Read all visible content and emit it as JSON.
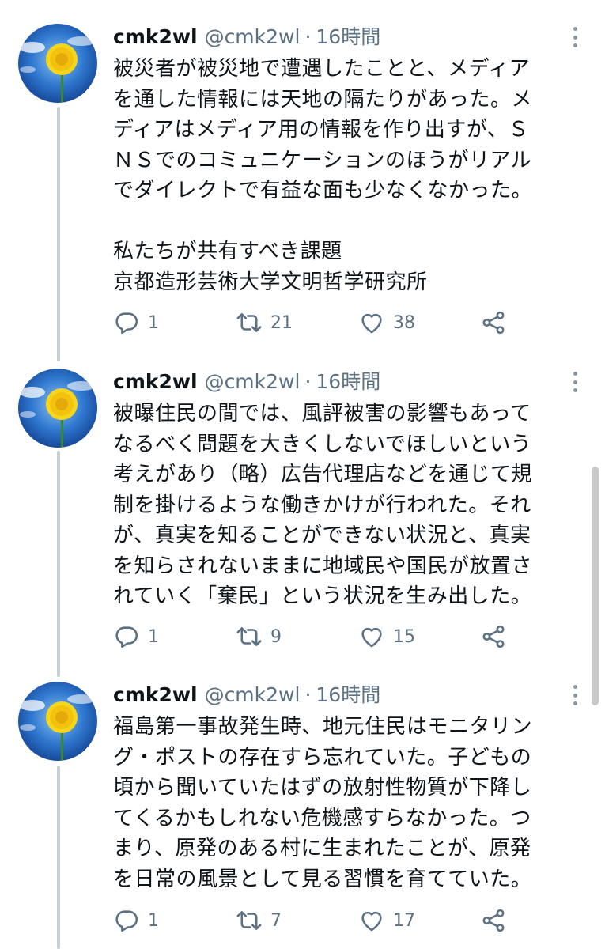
{
  "colors": {
    "text_primary": "#0f1419",
    "text_secondary": "#5b7083",
    "thread_line": "#c4cfd6",
    "avatar_sky": "#1f5fb8",
    "avatar_flower": "#f2d21a"
  },
  "icons": {
    "reply": "speech-bubble",
    "retweet": "retweet-arrows",
    "like": "heart",
    "share": "share-nodes",
    "more": "vertical-dots"
  },
  "tweets": [
    {
      "name": "cmk2wl",
      "handle": "@cmk2wl",
      "separator": "·",
      "time": "16時間",
      "text": "被災者が被災地で遭遇したことと、メディア\nを通した情報には天地の隔たりがあった。メ\nディアはメディア用の情報を作り出すが、Ｓ\nＮＳでのコミュニケーションのほうがリアル\nでダイレクトで有益な面も少なくなかった。\n\n私たちが共有すべき課題\n京都造形芸術大学文明哲学研究所",
      "replies": "1",
      "retweets": "21",
      "likes": "38"
    },
    {
      "name": "cmk2wl",
      "handle": "@cmk2wl",
      "separator": "·",
      "time": "16時間",
      "text": "被曝住民の間では、風評被害の影響もあって\nなるべく問題を大きくしないでほしいという\n考えがあり（略）広告代理店などを通じて規\n制を掛けるような働きかけが行われた。それ\nが、真実を知ることができない状況と、真実\nを知らされないままに地域民や国民が放置さ\nれていく「棄民」という状況を生み出した。",
      "replies": "1",
      "retweets": "9",
      "likes": "15"
    },
    {
      "name": "cmk2wl",
      "handle": "@cmk2wl",
      "separator": "·",
      "time": "16時間",
      "text": "福島第一事故発生時、地元住民はモニタリン\nグ・ポストの存在すら忘れていた。子どもの\n頃から聞いていたはずの放射性物質が下降し\nてくるかもしれない危機感すらなかった。つ\nまり、原発のある村に生まれたことが、原発\nを日常の風景として見る習慣を育てていた。",
      "replies": "1",
      "retweets": "7",
      "likes": "17"
    }
  ]
}
